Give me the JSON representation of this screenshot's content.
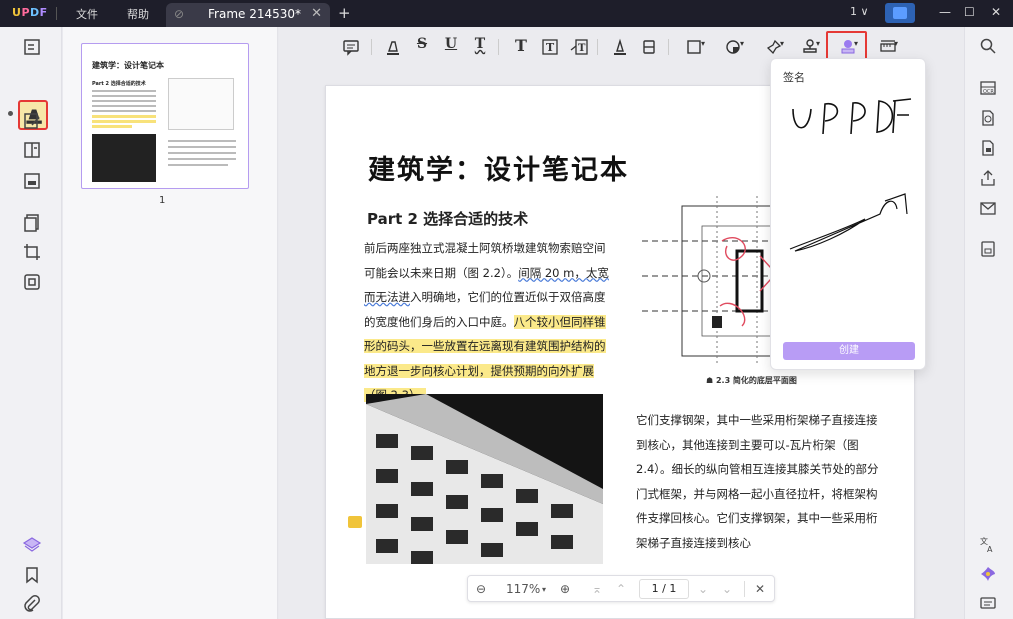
{
  "app": {
    "logo": "UPDF",
    "menu": [
      "文件",
      "帮助"
    ],
    "tab_title": "Frame 214530*",
    "tab_count": "1"
  },
  "toolbar": {
    "tools": [
      "comment-icon",
      "highlight-icon",
      "strikethrough-icon",
      "underline-icon",
      "squiggly-icon",
      "text-icon",
      "textbox-icon",
      "text-callout-icon",
      "pencil-icon",
      "eraser-icon",
      "shape-icon",
      "sticker-icon",
      "pin-icon",
      "stamp-icon",
      "signature-icon",
      "measure-icon"
    ],
    "active_tool": "signature-icon"
  },
  "document": {
    "title": "建筑学：设计笔记本",
    "section": "Part 2   选择合适的技术",
    "para1_a": "前后两座独立式混凝土阿筑桥墩建筑物索赔空间可能会以未来日期（图 2.2）。",
    "para1_wavy": "间隔 20 m，太宽而无法进",
    "para1_b": "入明确地，它们的位置近似于双倍高度的宽度他们身后的入口中庭。",
    "para1_hl": "八个较小但同样锥形的码头，一些放置在远离现有建筑围护结构的地方退一步向核心计划，提供预期的向外扩展（图 2.3）。",
    "figure_caption": "2.3  简化的底层平面图",
    "para2": "它们支撑钢架，其中一些采用桁架梯子直接连接到核心，其他连接到主要可以-瓦片桁架（图 2.4）。细长的纵向管相互连接其膝关节处的部分门式框架，并与网格一起小直径拉杆，将框架构件支撑回核心。它们支撑钢架，其中一些采用桁架梯子直接连接到核心"
  },
  "thumbnails": {
    "page_number": "1",
    "thumb_title": "建筑学：设计笔记本",
    "thumb_part": "Part 2  选择合适的技术"
  },
  "signature_panel": {
    "label": "签名",
    "create_button": "创建"
  },
  "zoom": {
    "level": "117%",
    "page_current": "1",
    "page_sep": "/",
    "page_total": "1"
  }
}
